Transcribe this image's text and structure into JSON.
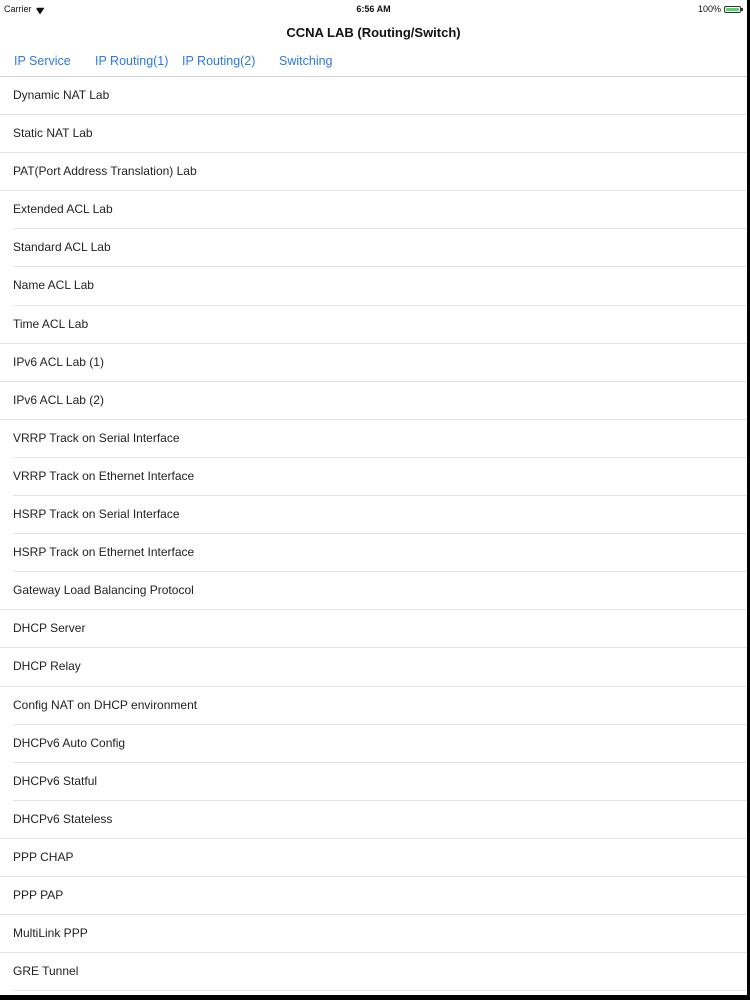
{
  "status_bar": {
    "carrier": "Carrier",
    "time": "6:56 AM",
    "battery": "100%",
    "battery_level": 1.0
  },
  "nav": {
    "title": "CCNA LAB (Routing/Switch)"
  },
  "tabs": [
    {
      "label": "IP Service"
    },
    {
      "label": "IP Routing(1)"
    },
    {
      "label": "IP Routing(2)"
    },
    {
      "label": "Switching"
    }
  ],
  "list_items": [
    {
      "label": "Dynamic NAT Lab"
    },
    {
      "label": "Static NAT Lab"
    },
    {
      "label": "PAT(Port Address Translation) Lab"
    },
    {
      "label": "Extended ACL Lab"
    },
    {
      "label": "Standard ACL Lab"
    },
    {
      "label": "Name ACL Lab"
    },
    {
      "label": "Time ACL Lab"
    },
    {
      "label": "IPv6 ACL Lab (1)"
    },
    {
      "label": "IPv6 ACL Lab (2)"
    },
    {
      "label": "VRRP Track on Serial Interface"
    },
    {
      "label": "VRRP Track on Ethernet Interface"
    },
    {
      "label": "HSRP Track on Serial Interface"
    },
    {
      "label": "HSRP Track on Ethernet Interface"
    },
    {
      "label": "Gateway Load Balancing Protocol"
    },
    {
      "label": "DHCP Server"
    },
    {
      "label": "DHCP Relay"
    },
    {
      "label": "Config NAT on DHCP environment"
    },
    {
      "label": "DHCPv6 Auto Config"
    },
    {
      "label": "DHCPv6 Statful"
    },
    {
      "label": "DHCPv6 Stateless"
    },
    {
      "label": "PPP CHAP"
    },
    {
      "label": "PPP PAP"
    },
    {
      "label": "MultiLink PPP"
    },
    {
      "label": "GRE Tunnel"
    }
  ],
  "colors": {
    "accent": "#2a7ae2",
    "battery": "#4cd964",
    "separator": "#e3e3e3"
  }
}
